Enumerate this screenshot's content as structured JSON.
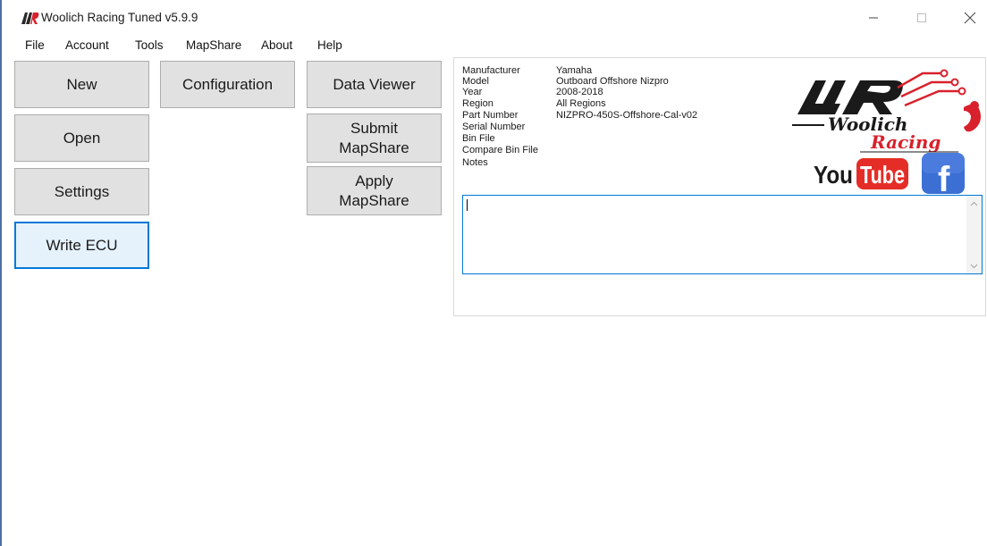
{
  "window": {
    "title": "Woolich Racing Tuned v5.9.9"
  },
  "menu": {
    "items": [
      "File",
      "Account",
      "Tools",
      "MapShare",
      "About",
      "Help"
    ]
  },
  "buttons": {
    "new": "New",
    "open": "Open",
    "settings": "Settings",
    "write_ecu": "Write ECU",
    "configuration": "Configuration",
    "data_viewer": "Data Viewer",
    "submit_mapshare": "Submit\nMapShare",
    "apply_mapshare": "Apply\nMapShare"
  },
  "info": {
    "labels": {
      "manufacturer": "Manufacturer",
      "model": "Model",
      "year": "Year",
      "region": "Region",
      "part_number": "Part Number",
      "serial_number": "Serial Number",
      "bin_file": "Bin File",
      "compare_bin_file": "Compare Bin File",
      "notes": "Notes"
    },
    "values": {
      "manufacturer": "Yamaha",
      "model": "Outboard Offshore Nizpro",
      "year": "2008-2018",
      "region": "All Regions",
      "part_number": "NIZPRO-450S-Offshore-Cal-v02",
      "serial_number": "",
      "bin_file": "",
      "compare_bin_file": ""
    },
    "notes_value": ""
  },
  "logos": {
    "brand_text": "Woolich",
    "brand_sub": "Racing",
    "youtube_you": "You",
    "youtube_tube": "Tube",
    "facebook_letter": "f"
  },
  "colors": {
    "accent": "#0078d7",
    "button_bg": "#e1e1e1",
    "focused_bg": "#e5f1fb",
    "brand_red": "#d8212c",
    "youtube_red": "#e52d27",
    "facebook_blue": "#3b6fd4"
  }
}
